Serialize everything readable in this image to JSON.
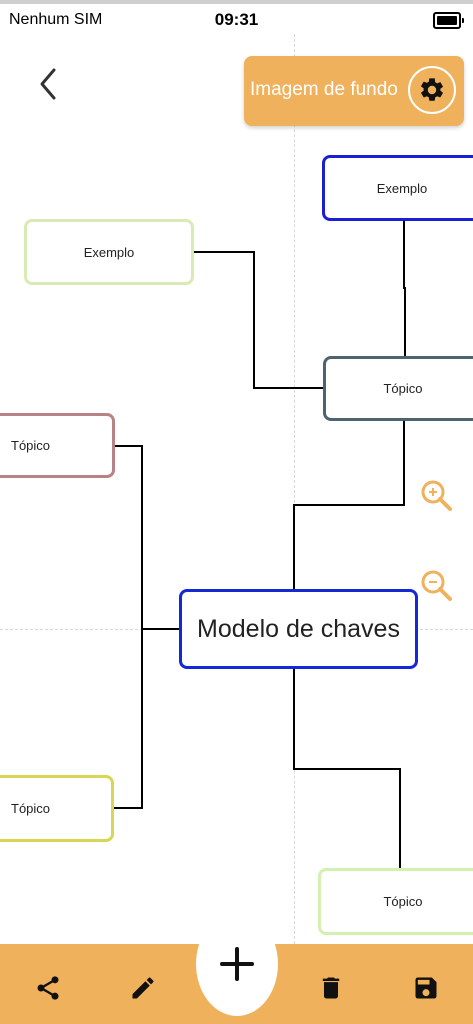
{
  "status_bar": {
    "carrier": "Nenhum SIM",
    "time": "09:31"
  },
  "header": {
    "background_button_label": "Imagem de fundo"
  },
  "mindmap": {
    "main_node": "Modelo de chaves",
    "nodes": {
      "top_example": "Exemplo",
      "left_example": "Exemplo",
      "right_topic": "Tópico",
      "left_topic_1": "Tópico",
      "left_topic_2": "Tópico",
      "bottom_topic": "Tópico"
    }
  },
  "colors": {
    "accent": "#f0b15c",
    "main_border": "#1428d8",
    "top_example_border": "#1a1fd0",
    "left_example_border": "#d9ebb4",
    "right_topic_border": "#4d6470",
    "left_topic_1_border": "#b88386",
    "left_topic_2_border": "#d8d653",
    "bottom_topic_border": "#d3efb1",
    "connector": "#000000"
  },
  "icons": {
    "back": "chevron-left-icon",
    "settings": "gear-icon",
    "zoom_in": "zoom-in-icon",
    "zoom_out": "zoom-out-icon",
    "share": "share-icon",
    "edit": "pencil-icon",
    "add": "plus-icon",
    "delete": "trash-icon",
    "save": "save-icon"
  }
}
